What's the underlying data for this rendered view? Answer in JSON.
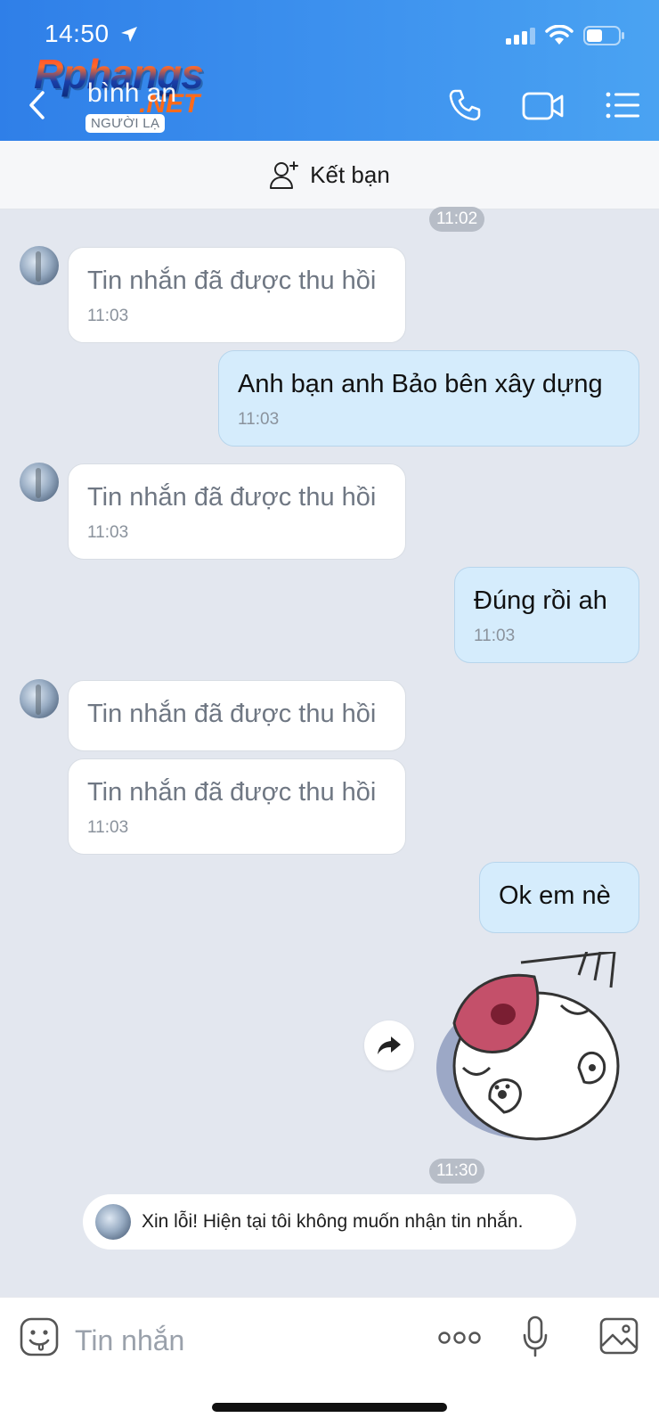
{
  "status_bar": {
    "time": "14:50"
  },
  "watermark": {
    "brand": "Rphangs",
    "suffix": ".NET"
  },
  "header": {
    "contact_name": "bình an",
    "badge": "NGƯỜI LẠ",
    "icons": [
      "back-icon",
      "phone-icon",
      "video-call-icon",
      "menu-icon"
    ]
  },
  "friend_bar": {
    "label": "Kết bạn",
    "icon": "add-friend-icon"
  },
  "messages": {
    "time_top": "11:02",
    "m1": {
      "text": "Tin nhắn đã được thu hồi",
      "time": "11:03"
    },
    "m2": {
      "text": "Anh bạn anh Bảo bên xây dựng",
      "time": "11:03"
    },
    "m3": {
      "text": "Tin nhắn đã được thu hồi",
      "time": "11:03"
    },
    "m4": {
      "text": "Đúng rồi ah",
      "time": "11:03"
    },
    "m5": {
      "text": "Tin nhắn đã được thu hồi"
    },
    "m6": {
      "text": "Tin nhắn đã được thu hồi",
      "time": "11:03"
    },
    "m7": {
      "text": "Ok em nè"
    },
    "time_sticker": "11:30",
    "system": "Xin lỗi! Hiện tại tôi không muốn nhận tin nhắn."
  },
  "input_bar": {
    "placeholder": "Tin nhắn",
    "icons": [
      "sticker-icon",
      "more-icon",
      "microphone-icon",
      "image-icon"
    ]
  },
  "colors": {
    "header_gradient_start": "#2f7fe8",
    "header_gradient_end": "#4aa3f2",
    "chat_bg": "#e3e7ef",
    "outgoing_bubble": "#d5ecfc",
    "incoming_bubble": "#ffffff"
  }
}
